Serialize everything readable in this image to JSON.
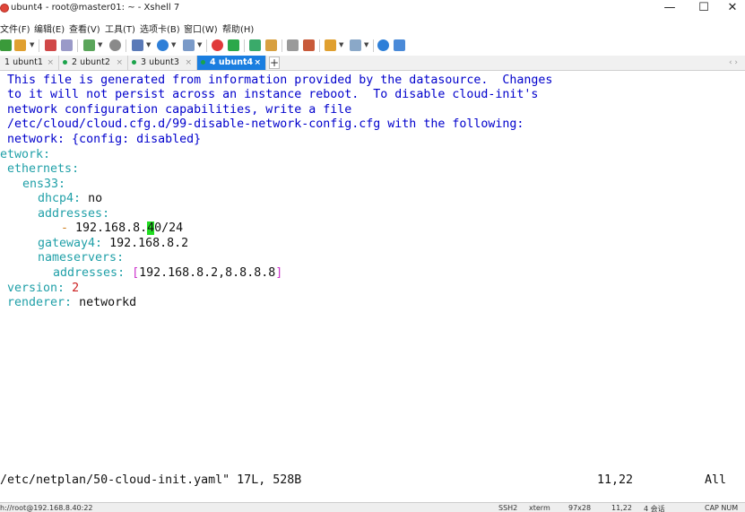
{
  "window": {
    "title": "ubunt4 - root@master01: ~ - Xshell 7",
    "minimize": "—",
    "maximize": "☐",
    "close": "✕"
  },
  "menu": [
    "文件(F)",
    "编辑(E)",
    "查看(V)",
    "工具(T)",
    "选项卡(B)",
    "窗口(W)",
    "帮助(H)"
  ],
  "tabs": [
    {
      "label": "1 ubunt1",
      "dot": false,
      "active": false
    },
    {
      "label": "2 ubunt2",
      "dot": true,
      "active": false
    },
    {
      "label": "3 ubunt3",
      "dot": true,
      "active": false
    },
    {
      "label": "4 ubunt4",
      "dot": true,
      "active": true
    }
  ],
  "tab_add": "+",
  "tab_close": "×",
  "tab_scroll": "‹ ›",
  "terminal": {
    "comment_lines": [
      " This file is generated from information provided by the datasource.  Changes",
      " to it will not persist across an instance reboot.  To disable cloud-init's",
      " network configuration capabilities, write a file",
      " /etc/cloud/cloud.cfg.d/99-disable-network-config.cfg with the following:",
      " network: {config: disabled}"
    ],
    "network_key": "etwork",
    "ethernets_key": "ethernets",
    "iface_key": "ens33",
    "dhcp4_key": "dhcp4",
    "dhcp4_value": "no",
    "addresses_key": "addresses",
    "dash": "-",
    "address_prefix": "192.168.8.",
    "address_cursor": "4",
    "address_suffix": "0/24",
    "gateway4_key": "gateway4",
    "gateway4_value": "192.168.8.2",
    "nameservers_key": "nameservers",
    "ns_addresses_key": "addresses",
    "ns_addresses_value": "192.168.8.2,8.8.8.8",
    "version_key": "version",
    "version_value": "2",
    "renderer_key": "renderer",
    "renderer_value": "networkd",
    "colon": ":",
    "open_bracket": "[",
    "close_bracket": "]",
    "status_file": "/etc/netplan/50-cloud-init.yaml\" 17L, 528B",
    "status_pos": "11,22",
    "status_all": "All"
  },
  "statusbar": {
    "connection": "h://root@192.168.8.40:22",
    "protocol": "SSH2",
    "term": "xterm",
    "size": "97x28",
    "cursor": "11,22",
    "sessions": "4 会话",
    "caps": "CAP NUM"
  }
}
